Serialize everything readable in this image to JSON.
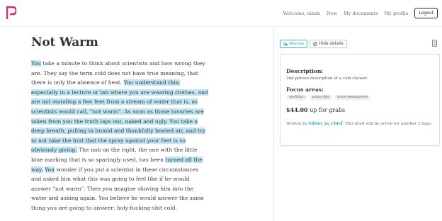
{
  "nav": {
    "welcome": "Welcome, ninda",
    "new": "New",
    "my_documents": "My documents",
    "my_profile": "My profile",
    "logout": "Logout"
  },
  "article": {
    "title": "Not Warm",
    "segments": [
      {
        "text": "You",
        "hl": true
      },
      {
        "text": " take a minute to think about scientists and how wrong they are. They say the term cold does not have true meaning, that there is only the absence of heat. ",
        "hl": false
      },
      {
        "text": "You understand this; especially in a lecture or lab where you are wearing clothes, and are not standing a few feet from a stream of water that is, as scientists would call, \"not warm\". As soon as those luxuries are taken from you the truth lays out, naked and ugly. You take a deep breath, pulling in humid and thankfully heated air, and try to not take the hint that the spray against your feet is so obviously giving.",
        "hl": true
      },
      {
        "text": " The nob on the right, the one with the little blue marking that is so sparingly used, has been ",
        "hl": false
      },
      {
        "text": "turned all the way.",
        "hl": true
      },
      {
        "text": " ",
        "hl": false
      },
      {
        "text": "You",
        "hl": true
      },
      {
        "text": " wonder if you put a scientist in these circumstances and asked him what this was going to feel like if he would answer \"not warm\". Then you imagine shoving him into the water and asking again. You believe he would answer the same thing you are going to answer: holy-fucking-shit cold.",
        "hl": false
      }
    ]
  },
  "sidebar": {
    "discuss_label": "Discuss",
    "hide_details_label": "Hide details",
    "description_label": "Description:",
    "description": "2nd person description of a cold shower.",
    "focus_label": "Focus areas:",
    "tags": [
      "nonfiction",
      "prose style",
      "scene development"
    ],
    "price": "$44.00",
    "price_suffix": " up for grabs",
    "written_prefix": "Written by ",
    "author": "Editor_in_Chief",
    "written_suffix": ". This draft will be active for another 2 days."
  },
  "colors": {
    "highlight": "#bfe6f5",
    "accent": "#e8236b",
    "teal": "#2fa9b3"
  },
  "icons": {
    "logo": "brand-logo",
    "discuss": "chat-bubbles-icon",
    "hide": "no-sign-icon",
    "document": "document-icon"
  }
}
